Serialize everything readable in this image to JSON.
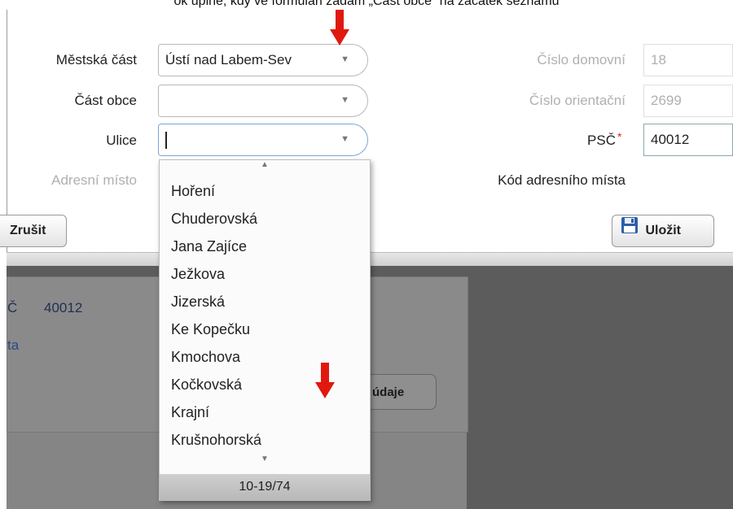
{
  "caption": "ok uplne, kdy ve formulari zadam „Cast obce“ na zacatek seznamu",
  "form": {
    "mestska_cast": {
      "label": "Městská část",
      "value": "Ústí nad Labem-Sev"
    },
    "cast_obce": {
      "label": "Část obce",
      "value": ""
    },
    "ulice": {
      "label": "Ulice",
      "value": ""
    },
    "adresni_misto": {
      "label": "Adresní místo"
    },
    "cislo_domovni": {
      "label": "Číslo domovní",
      "value": "18"
    },
    "cislo_orientacni": {
      "label": "Číslo orientační",
      "value": "2699"
    },
    "psc": {
      "label": "PSČ",
      "required_mark": "*",
      "value": "40012"
    },
    "kod_adresniho_mista": {
      "label": "Kód adresního místa"
    }
  },
  "buttons": {
    "cancel": "Zrušit",
    "save": "Uložit"
  },
  "dropdown": {
    "items": [
      "Hoření",
      "Chuderovská",
      "Jana Zajíce",
      "Ježkova",
      "Jizerská",
      "Ke Kopečku",
      "Kmochova",
      "Kočkovská",
      "Krajní",
      "Krušnohorská"
    ],
    "pager": "10-19/74"
  },
  "background": {
    "psc_label": "Č",
    "psc_value": "40012",
    "partial_label": "ta",
    "button": "údaje"
  },
  "colors": {
    "annotation_arrow": "#e0190f",
    "required": "#dd2222",
    "dim_overlay": "#5c5c5c"
  }
}
